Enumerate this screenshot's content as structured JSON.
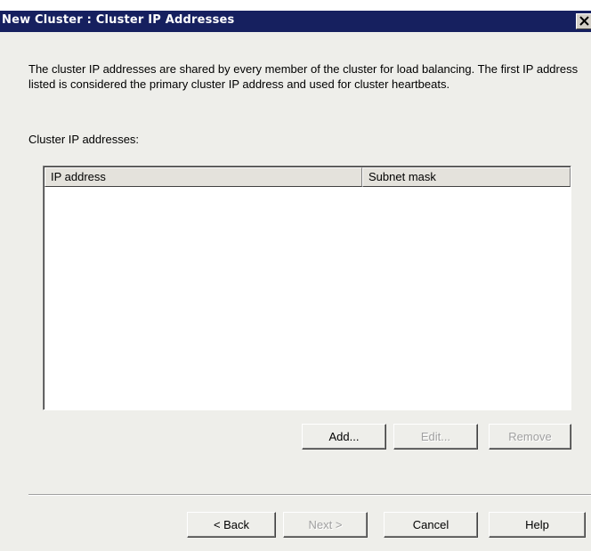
{
  "window": {
    "title": "New Cluster : Cluster IP Addresses"
  },
  "description": "The cluster IP addresses are shared by every member of the cluster for load balancing. The first IP address listed is considered the primary cluster IP address and used for cluster heartbeats.",
  "list": {
    "label": "Cluster IP addresses:",
    "columns": [
      "IP address",
      "Subnet mask"
    ],
    "rows": []
  },
  "list_buttons": {
    "add": "Add...",
    "edit": "Edit...",
    "remove": "Remove"
  },
  "footer_buttons": {
    "back": "< Back",
    "next": "Next >",
    "cancel": "Cancel",
    "help": "Help"
  },
  "icons": {
    "close": "close-icon"
  },
  "colors": {
    "titlebar": "#16205f",
    "dialog_background": "#eeeeea",
    "disabled_text": "#a0a0a0"
  }
}
